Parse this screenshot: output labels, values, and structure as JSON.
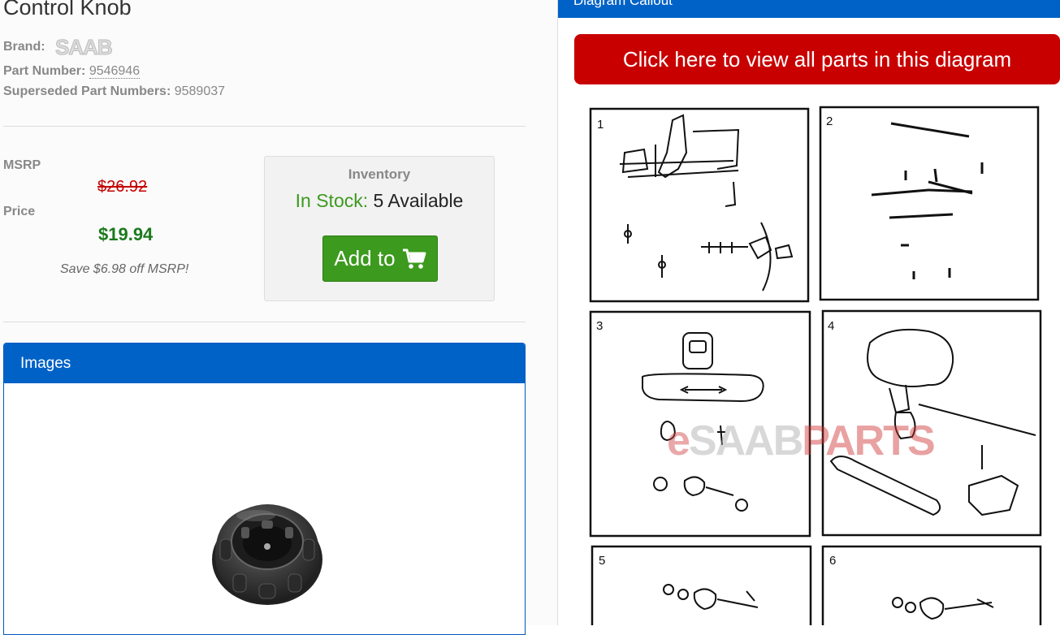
{
  "product": {
    "title": "Control Knob",
    "brand_label": "Brand:",
    "brand_logo_text": "SAAB",
    "part_number_label": "Part Number:",
    "part_number": "9546946",
    "superseded_label": "Superseded Part Numbers:",
    "superseded": "9589037"
  },
  "pricing": {
    "msrp_label": "MSRP",
    "msrp": "$26.92",
    "price_label": "Price",
    "price": "$19.94",
    "savings": "Save $6.98 off MSRP!"
  },
  "inventory": {
    "title": "Inventory",
    "status": "In Stock:",
    "available": "5 Available",
    "add_button": "Add to"
  },
  "images_panel": {
    "title": "Images"
  },
  "diagram": {
    "header": "Diagram Callout",
    "view_all_button": "Click here to view all parts in this diagram",
    "panel_numbers": [
      "1",
      "2",
      "3",
      "4",
      "5",
      "6"
    ],
    "watermark": {
      "e": "e",
      "saab": "SAAB",
      "parts": "PARTS"
    }
  },
  "colors": {
    "accent_blue": "#0062c7",
    "cta_red": "#c80000",
    "in_stock_green": "#3c9a1e",
    "msrp_red": "#c40000",
    "price_green": "#1c7a1c"
  },
  "icons": [
    "cart-icon",
    "brand-logo",
    "product-photo",
    "parts-diagram"
  ]
}
